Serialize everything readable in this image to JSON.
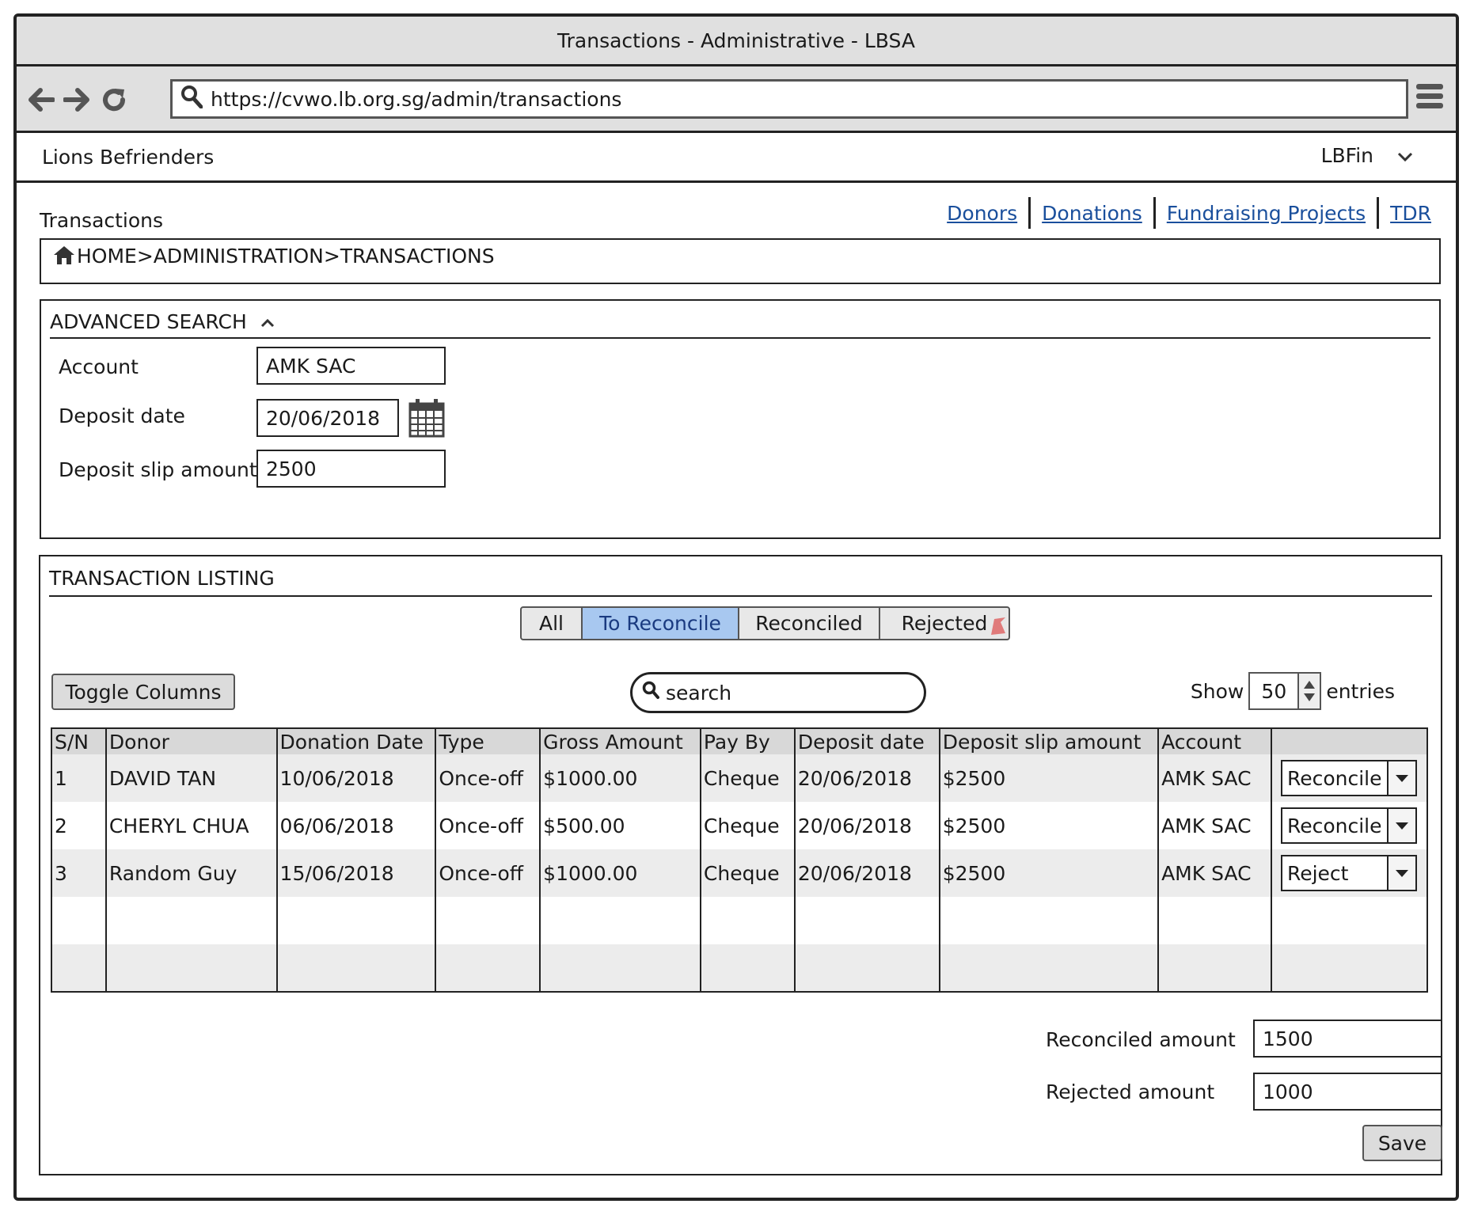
{
  "window": {
    "title": "Transactions - Administrative - LBSA"
  },
  "browser": {
    "url": "https://cvwo.lb.org.sg/admin/transactions"
  },
  "app": {
    "brand": "Lions Befrienders",
    "user": "LBFin"
  },
  "page": {
    "title": "Transactions"
  },
  "top_links": [
    "Donors",
    "Donations",
    "Fundraising Projects",
    "TDR"
  ],
  "breadcrumb": {
    "text": "HOME>ADMINISTRATION>TRANSACTIONS"
  },
  "advanced_search": {
    "heading": "ADVANCED SEARCH",
    "account_label": "Account",
    "account_value": "AMK SAC",
    "deposit_date_label": "Deposit date",
    "deposit_date_value": "20/06/2018",
    "slip_amount_label": "Deposit slip amount",
    "slip_amount_value": "2500"
  },
  "listing": {
    "heading": "TRANSACTION LISTING",
    "tabs": [
      "All",
      "To Reconcile",
      "Reconciled",
      "Rejected"
    ],
    "active_tab": "To Reconcile",
    "toggle_columns": "Toggle Columns",
    "search_placeholder": "search",
    "show_label": "Show",
    "show_value": "50",
    "entries_label": "entries",
    "columns": [
      "S/N",
      "Donor",
      "Donation Date",
      "Type",
      "Gross Amount",
      "Pay By",
      "Deposit date",
      "Deposit slip amount",
      "Account",
      ""
    ],
    "rows": [
      {
        "sn": "1",
        "donor": "DAVID TAN",
        "donation_date": "10/06/2018",
        "type": "Once-off",
        "gross": "$1000.00",
        "pay_by": "Cheque",
        "deposit_date": "20/06/2018",
        "slip": "$2500",
        "account": "AMK SAC",
        "action": "Reconcile"
      },
      {
        "sn": "2",
        "donor": "CHERYL CHUA",
        "donation_date": "06/06/2018",
        "type": "Once-off",
        "gross": "$500.00",
        "pay_by": "Cheque",
        "deposit_date": "20/06/2018",
        "slip": "$2500",
        "account": "AMK SAC",
        "action": "Reconcile"
      },
      {
        "sn": "3",
        "donor": "Random Guy",
        "donation_date": "15/06/2018",
        "type": "Once-off",
        "gross": "$1000.00",
        "pay_by": "Cheque",
        "deposit_date": "20/06/2018",
        "slip": "$2500",
        "account": "AMK SAC",
        "action": "Reject"
      }
    ],
    "reconciled_label": "Reconciled amount",
    "reconciled_value": "1500",
    "rejected_label": "Rejected amount",
    "rejected_value": "1000",
    "save": "Save"
  },
  "colors": {
    "active_tab_bg": "#a8c8f0",
    "link": "#1a4f9c",
    "header_bg": "#e0e0e0"
  },
  "icons": [
    "back-arrow-icon",
    "forward-arrow-icon",
    "reload-icon",
    "search-icon",
    "hamburger-menu-icon",
    "chevron-down-icon",
    "home-icon",
    "chevron-up-icon",
    "calendar-icon",
    "dropdown-arrow-icon",
    "spinner-arrows-icon"
  ]
}
